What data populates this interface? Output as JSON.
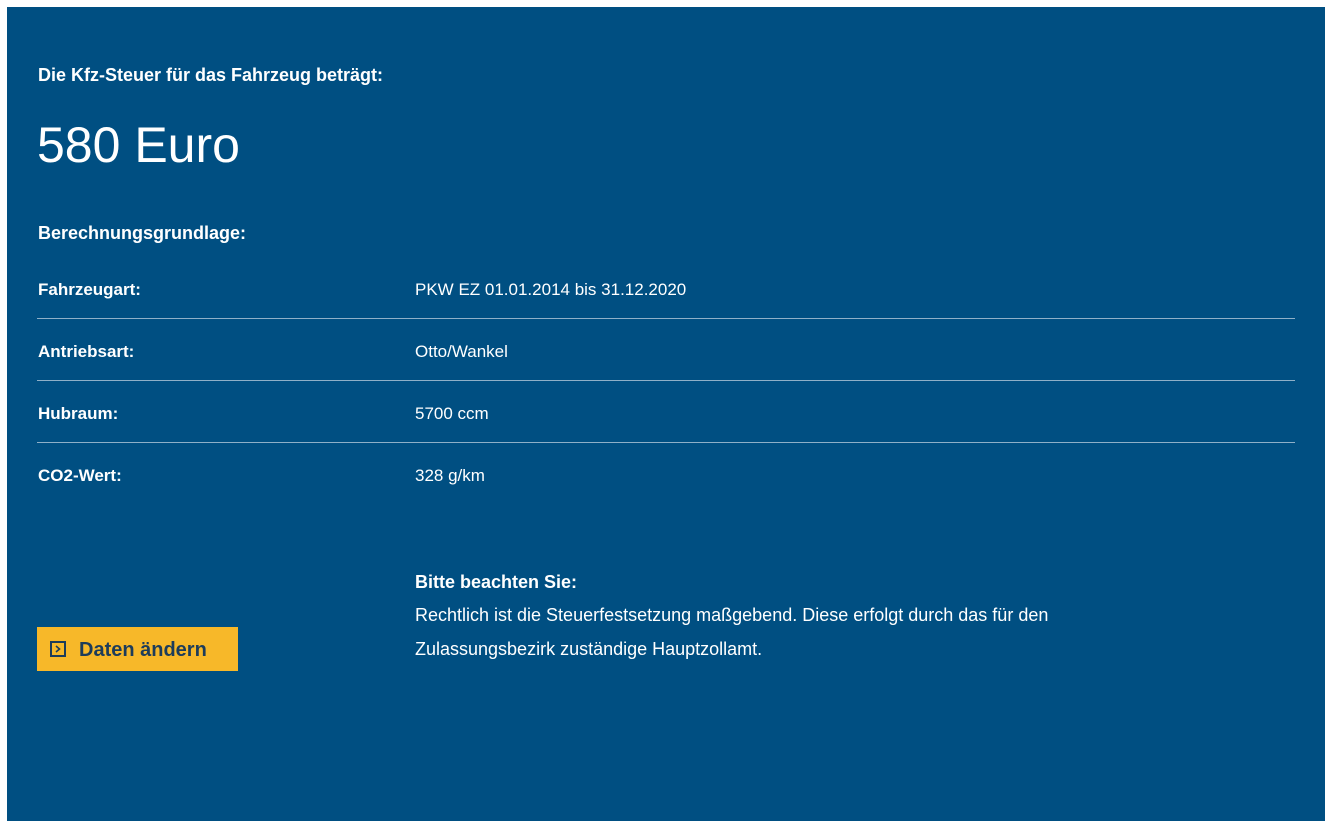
{
  "result": {
    "intro": "Die Kfz-Steuer für das Fahrzeug beträgt:",
    "amount": "580 Euro",
    "basis_heading": "Berechnungsgrundlage:"
  },
  "details": [
    {
      "label": "Fahrzeugart:",
      "value": "PKW EZ 01.01.2014 bis 31.12.2020"
    },
    {
      "label": "Antriebsart:",
      "value": "Otto/Wankel"
    },
    {
      "label": "Hubraum:",
      "value": "5700 ccm"
    },
    {
      "label": "CO2-Wert:",
      "value": "328 g/km"
    }
  ],
  "actions": {
    "change_data_label": "Daten ändern",
    "change_data_icon": "chevron-right-box-icon"
  },
  "notice": {
    "title": "Bitte beachten Sie:",
    "text": "Rechtlich ist die Steuerfestsetzung maßgebend. Diese erfolgt durch das für den Zulassungsbezirk zuständige Hauptzollamt."
  },
  "colors": {
    "panel_background": "#004f82",
    "button_background": "#f7b829",
    "button_text": "#1d3c5a",
    "divider": "#8fb0c8"
  }
}
